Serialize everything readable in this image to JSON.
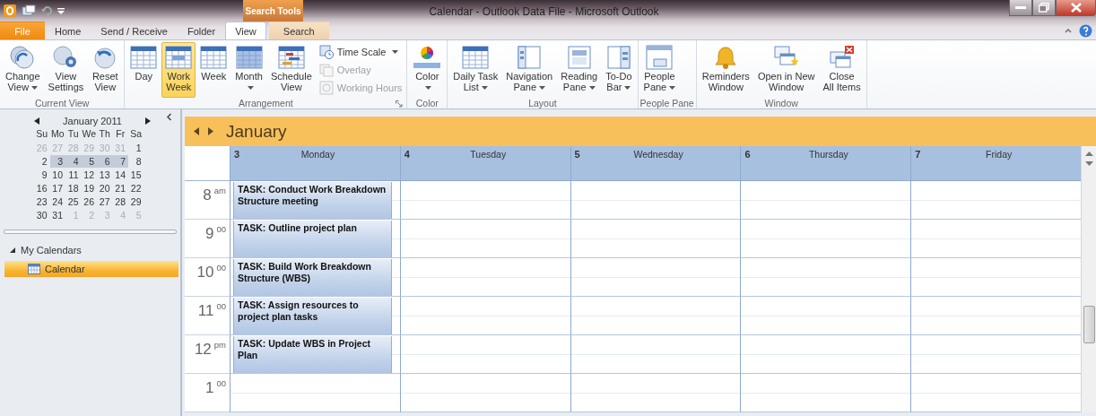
{
  "window": {
    "title": "Calendar - Outlook Data File - Microsoft Outlook"
  },
  "contextual_group": "Search Tools",
  "tabs": [
    {
      "label": "File",
      "kind": "file",
      "selected": false
    },
    {
      "label": "Home",
      "kind": "tab",
      "selected": false
    },
    {
      "label": "Send / Receive",
      "kind": "tab",
      "selected": false
    },
    {
      "label": "Folder",
      "kind": "tab",
      "selected": false
    },
    {
      "label": "View",
      "kind": "tab",
      "selected": true
    },
    {
      "label": "Search",
      "kind": "contextual",
      "selected": false
    }
  ],
  "ribbon": {
    "groups": [
      {
        "label": "Current View",
        "buttons": [
          {
            "kind": "change-view",
            "lines": [
              "Change",
              "View"
            ],
            "dropdown": true
          },
          {
            "kind": "view-settings",
            "lines": [
              "View",
              "Settings"
            ],
            "dropdown": false
          },
          {
            "kind": "reset-view",
            "lines": [
              "Reset",
              "View"
            ],
            "dropdown": false
          }
        ]
      },
      {
        "label": "Arrangement",
        "launcher": true,
        "buttons": [
          {
            "kind": "day",
            "lines": [
              "Day"
            ],
            "dropdown": false,
            "selected": false
          },
          {
            "kind": "work-week",
            "lines": [
              "Work",
              "Week"
            ],
            "dropdown": false,
            "selected": true
          },
          {
            "kind": "week",
            "lines": [
              "Week"
            ],
            "dropdown": false,
            "selected": false
          },
          {
            "kind": "month",
            "lines": [
              "Month"
            ],
            "dropdown": true,
            "selected": false
          },
          {
            "kind": "schedule",
            "lines": [
              "Schedule",
              "View"
            ],
            "dropdown": false,
            "selected": false
          }
        ],
        "small_buttons": [
          {
            "kind": "time-scale",
            "label": "Time Scale",
            "dropdown": true,
            "disabled": false
          },
          {
            "kind": "overlay",
            "label": "Overlay",
            "dropdown": false,
            "disabled": true
          },
          {
            "kind": "working-hours",
            "label": "Working Hours",
            "dropdown": false,
            "disabled": true
          }
        ]
      },
      {
        "label": "Color",
        "buttons": [
          {
            "kind": "color",
            "lines": [
              "Color"
            ],
            "dropdown": true
          }
        ]
      },
      {
        "label": "Layout",
        "buttons": [
          {
            "kind": "task-list",
            "lines": [
              "Daily Task",
              "List"
            ],
            "dropdown": true
          },
          {
            "kind": "navigation-pane",
            "lines": [
              "Navigation",
              "Pane"
            ],
            "dropdown": true
          },
          {
            "kind": "reading-pane",
            "lines": [
              "Reading",
              "Pane"
            ],
            "dropdown": true
          },
          {
            "kind": "todo-bar",
            "lines": [
              "To-Do",
              "Bar"
            ],
            "dropdown": true
          }
        ]
      },
      {
        "label": "People Pane",
        "buttons": [
          {
            "kind": "people-pane",
            "lines": [
              "People",
              "Pane"
            ],
            "dropdown": true
          }
        ]
      },
      {
        "label": "Window",
        "buttons": [
          {
            "kind": "reminders",
            "lines": [
              "Reminders",
              "Window"
            ],
            "dropdown": false
          },
          {
            "kind": "open-window",
            "lines": [
              "Open in New",
              "Window"
            ],
            "dropdown": false
          },
          {
            "kind": "close-all",
            "lines": [
              "Close",
              "All Items"
            ],
            "dropdown": false
          }
        ]
      }
    ]
  },
  "mini_calendar": {
    "month": "January 2011",
    "weekdays": [
      "Su",
      "Mo",
      "Tu",
      "We",
      "Th",
      "Fr",
      "Sa"
    ],
    "weeks": [
      [
        {
          "day": "26",
          "in_month": false,
          "selected": false
        },
        {
          "day": "27",
          "in_month": false,
          "selected": false
        },
        {
          "day": "28",
          "in_month": false,
          "selected": false
        },
        {
          "day": "29",
          "in_month": false,
          "selected": false
        },
        {
          "day": "30",
          "in_month": false,
          "selected": false
        },
        {
          "day": "31",
          "in_month": false,
          "selected": false
        },
        {
          "day": "1",
          "in_month": true,
          "selected": false
        }
      ],
      [
        {
          "day": "2",
          "in_month": true,
          "selected": false
        },
        {
          "day": "3",
          "in_month": true,
          "selected": true
        },
        {
          "day": "4",
          "in_month": true,
          "selected": true
        },
        {
          "day": "5",
          "in_month": true,
          "selected": true
        },
        {
          "day": "6",
          "in_month": true,
          "selected": true
        },
        {
          "day": "7",
          "in_month": true,
          "selected": true
        },
        {
          "day": "8",
          "in_month": true,
          "selected": false
        }
      ],
      [
        {
          "day": "9",
          "in_month": true,
          "selected": false
        },
        {
          "day": "10",
          "in_month": true,
          "selected": false
        },
        {
          "day": "11",
          "in_month": true,
          "selected": false
        },
        {
          "day": "12",
          "in_month": true,
          "selected": false
        },
        {
          "day": "13",
          "in_month": true,
          "selected": false
        },
        {
          "day": "14",
          "in_month": true,
          "selected": false
        },
        {
          "day": "15",
          "in_month": true,
          "selected": false
        }
      ],
      [
        {
          "day": "16",
          "in_month": true,
          "selected": false
        },
        {
          "day": "17",
          "in_month": true,
          "selected": false
        },
        {
          "day": "18",
          "in_month": true,
          "selected": false
        },
        {
          "day": "19",
          "in_month": true,
          "selected": false
        },
        {
          "day": "20",
          "in_month": true,
          "selected": false
        },
        {
          "day": "21",
          "in_month": true,
          "selected": false
        },
        {
          "day": "22",
          "in_month": true,
          "selected": false
        }
      ],
      [
        {
          "day": "23",
          "in_month": true,
          "selected": false
        },
        {
          "day": "24",
          "in_month": true,
          "selected": false
        },
        {
          "day": "25",
          "in_month": true,
          "selected": false
        },
        {
          "day": "26",
          "in_month": true,
          "selected": false
        },
        {
          "day": "27",
          "in_month": true,
          "selected": false
        },
        {
          "day": "28",
          "in_month": true,
          "selected": false
        },
        {
          "day": "29",
          "in_month": true,
          "selected": false
        }
      ],
      [
        {
          "day": "30",
          "in_month": true,
          "selected": false
        },
        {
          "day": "31",
          "in_month": true,
          "selected": false
        },
        {
          "day": "1",
          "in_month": false,
          "selected": false
        },
        {
          "day": "2",
          "in_month": false,
          "selected": false
        },
        {
          "day": "3",
          "in_month": false,
          "selected": false
        },
        {
          "day": "4",
          "in_month": false,
          "selected": false
        },
        {
          "day": "5",
          "in_month": false,
          "selected": false
        }
      ]
    ]
  },
  "folders": [
    {
      "label": "My Calendars",
      "expanded": true,
      "children": [
        {
          "label": "Calendar",
          "selected": true
        }
      ]
    }
  ],
  "calendar": {
    "title": "January",
    "days": [
      {
        "date": "3",
        "name": "Monday",
        "tasks": [
          "TASK: Conduct Work Breakdown Structure meeting",
          "TASK: Outline project plan",
          "TASK: Build Work Breakdown Structure (WBS)",
          "TASK: Assign resources to project plan tasks",
          "TASK: Update WBS in Project Plan"
        ]
      },
      {
        "date": "4",
        "name": "Tuesday"
      },
      {
        "date": "5",
        "name": "Wednesday"
      },
      {
        "date": "6",
        "name": "Thursday"
      },
      {
        "date": "7",
        "name": "Friday"
      }
    ],
    "hours": [
      {
        "hour": "8",
        "suffix": "am"
      },
      {
        "hour": "9",
        "suffix": "00"
      },
      {
        "hour": "10",
        "suffix": "00"
      },
      {
        "hour": "11",
        "suffix": "00"
      },
      {
        "hour": "12",
        "suffix": "pm"
      },
      {
        "hour": "1",
        "suffix": "00"
      }
    ]
  }
}
